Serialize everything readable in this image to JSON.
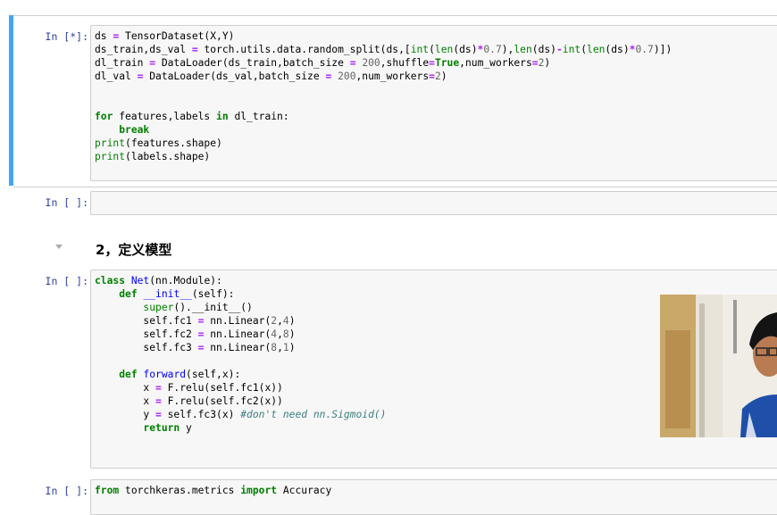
{
  "cells": [
    {
      "prompt": "In [*]:",
      "lines": [
        "ds = TensorDataset(X,Y)",
        "ds_train,ds_val = torch.utils.data.random_split(ds,[int(len(ds)*0.7),len(ds)-int(len(ds)*0.7)])",
        "dl_train = DataLoader(ds_train,batch_size = 200,shuffle=True,num_workers=2)",
        "dl_val = DataLoader(ds_val,batch_size = 200,num_workers=2)",
        "",
        "",
        "for features,labels in dl_train:",
        "    break",
        "print(features.shape)",
        "print(labels.shape)"
      ]
    },
    {
      "prompt": "In [ ]:",
      "lines": []
    },
    {
      "prompt": "In [ ]:",
      "lines": [
        "class Net(nn.Module):",
        "    def __init__(self):",
        "        super().__init__()",
        "        self.fc1 = nn.Linear(2,4)",
        "        self.fc2 = nn.Linear(4,8)",
        "        self.fc3 = nn.Linear(8,1)",
        "",
        "    def forward(self,x):",
        "        x = F.relu(self.fc1(x))",
        "        x = F.relu(self.fc2(x))",
        "        y = self.fc3(x) #don't need nn.Sigmoid()",
        "        return y"
      ]
    },
    {
      "prompt": "In [ ]:",
      "lines": [
        "from torchkeras.metrics import Accuracy"
      ]
    }
  ],
  "markdown": {
    "heading": "2，定义模型"
  },
  "colors": {
    "active_cell_bar": "#42A5F5",
    "prompt": "#303F9F",
    "keyword": "#008000",
    "number": "#666666",
    "operator": "#AA22FF",
    "function_name": "#0000FF",
    "comment": "#408080",
    "cell_background": "#f7f7f7"
  },
  "webcam_overlay": {
    "icon": "person-video-icon"
  }
}
